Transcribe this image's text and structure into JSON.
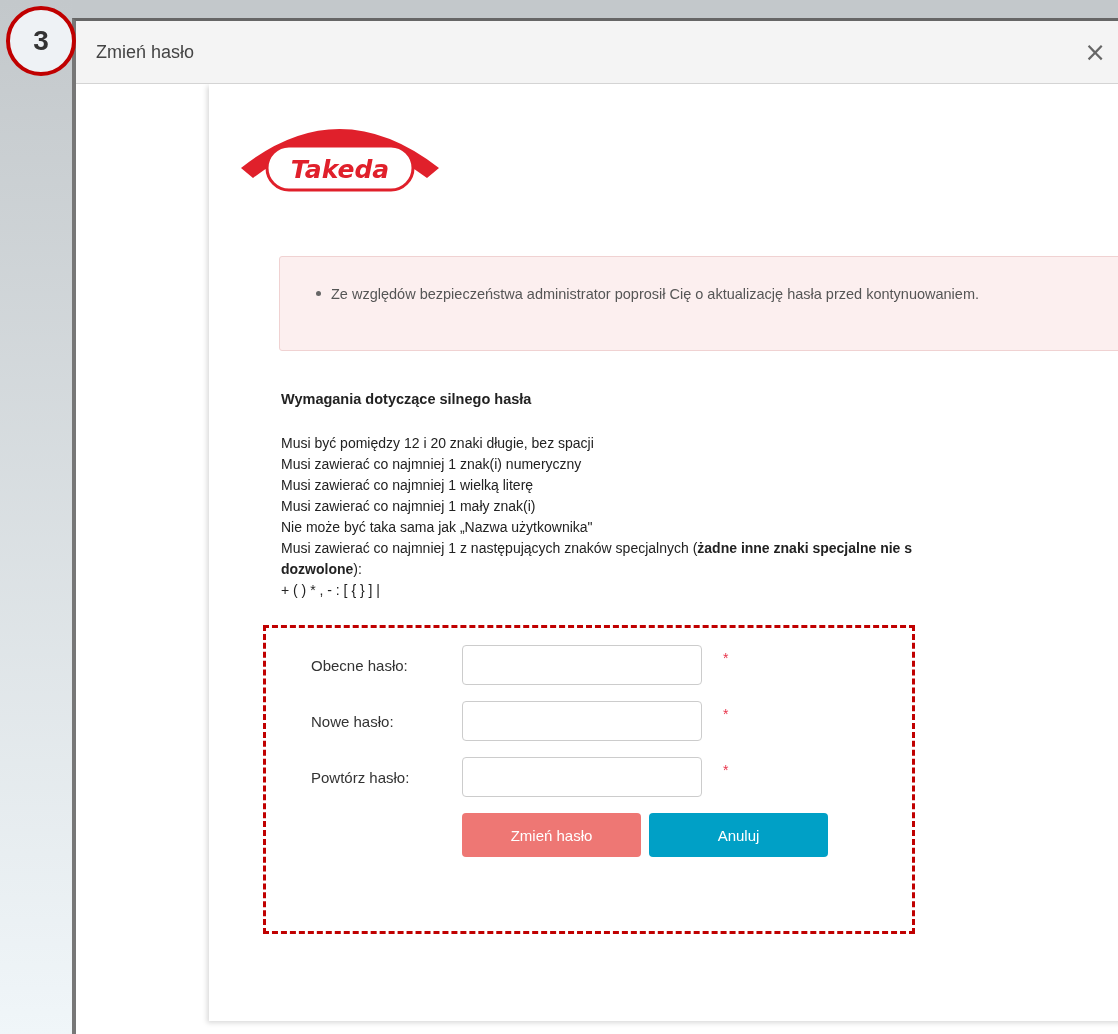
{
  "step_badge": "3",
  "dialog": {
    "title": "Zmień hasło",
    "close": "×"
  },
  "logo_text": "Takeda",
  "alert": {
    "message": "Ze względów bezpieczeństwa administrator poprosił Cię o aktualizację hasła przed kontynuowaniem."
  },
  "requirements": {
    "heading": "Wymagania dotyczące silnego hasła",
    "lines": [
      "Musi być pomiędzy 12 i 20 znaki długie, bez spacji",
      "Musi zawierać co najmniej 1 znak(i) numeryczny",
      "Musi zawierać co najmniej 1 wielką literę",
      "Musi zawierać co najmniej 1 mały znak(i)",
      "Nie może być taka sama jak „Nazwa użytkownika\"",
      "Musi zawierać co najmniej 1 z następujących znaków specjalnych (**żadne inne znaki specjalne nie s**",
      "**dozwolone**):",
      "+ ( ) * , - : [ { } ] |"
    ]
  },
  "form": {
    "fields": [
      {
        "label": "Obecne hasło:",
        "required": true
      },
      {
        "label": "Nowe hasło:",
        "required": true
      },
      {
        "label": "Powtórz hasło:",
        "required": true
      }
    ],
    "required_mark": "*",
    "buttons": [
      {
        "label": "Zmień hasło",
        "kind": "primary"
      },
      {
        "label": "Anuluj",
        "kind": "secondary"
      }
    ]
  }
}
